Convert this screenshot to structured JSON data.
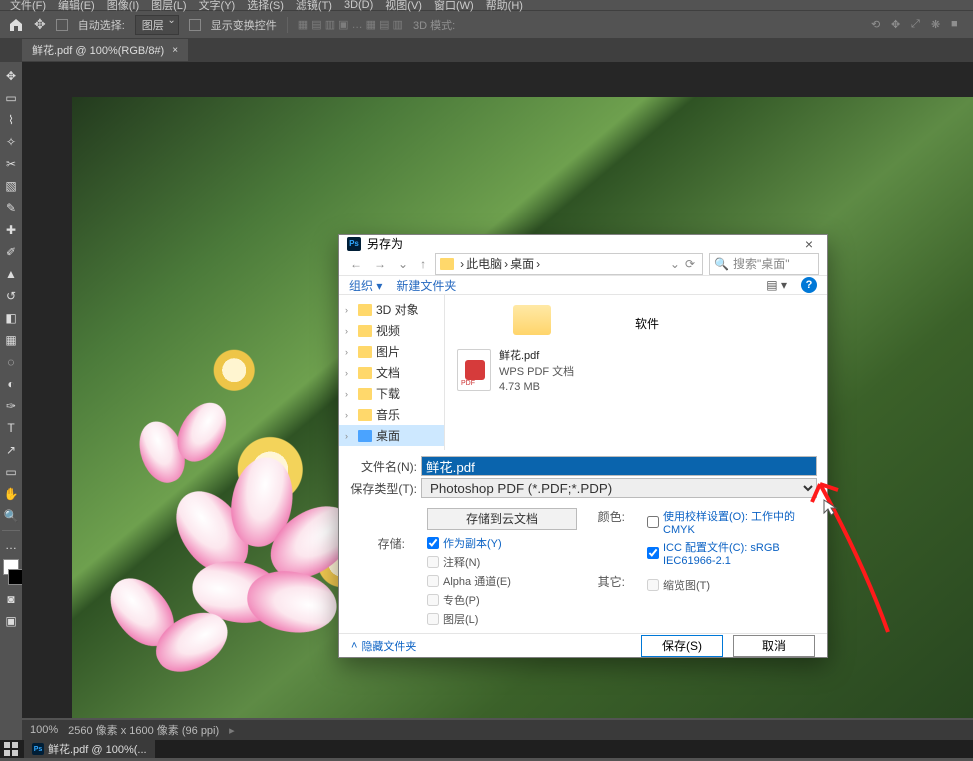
{
  "menu": {
    "file": "文件(F)",
    "edit": "编辑(E)",
    "image": "图像(I)",
    "layer": "图层(L)",
    "type": "文字(Y)",
    "select": "选择(S)",
    "filter": "滤镜(T)",
    "threeD": "3D(D)",
    "view": "视图(V)",
    "window": "窗口(W)",
    "help": "帮助(H)"
  },
  "options": {
    "autoSelect": "自动选择:",
    "layerDropdown": "图层",
    "transformCtrls": "显示变换控件",
    "threeDMode": "3D 模式:"
  },
  "tab": {
    "title": "鲜花.pdf @ 100%(RGB/8#)",
    "close": "×"
  },
  "dialog": {
    "title": "另存为",
    "nav": {
      "back": "←",
      "fwd": "→",
      "up": "↑",
      "refresh": "⟳",
      "crumb1": "此电脑",
      "crumb2": "桌面",
      "sep": "›",
      "searchPlaceholder": "搜索\"桌面\"",
      "dropdown": "⌄"
    },
    "toolbar": {
      "organize": "组织 ▾",
      "newFolder": "新建文件夹",
      "viewIcon": "☰",
      "help": "?"
    },
    "tree": [
      {
        "label": "3D 对象"
      },
      {
        "label": "视频"
      },
      {
        "label": "图片"
      },
      {
        "label": "文档"
      },
      {
        "label": "下载"
      },
      {
        "label": "音乐"
      },
      {
        "label": "桌面",
        "selected": true
      }
    ],
    "files": {
      "folder": {
        "name": "软件"
      },
      "pdf": {
        "name": "鲜花.pdf",
        "type": "WPS PDF 文档",
        "size": "4.73 MB"
      }
    },
    "fields": {
      "nameLabel": "文件名(N):",
      "nameValue": "鲜花.pdf",
      "typeLabel": "保存类型(T):",
      "typeValue": "Photoshop PDF (*.PDF;*.PDP)"
    },
    "opts": {
      "cloudBtn": "存储到云文档",
      "storeLabel": "存储:",
      "asCopy": "作为副本(Y)",
      "notes": "注释(N)",
      "alpha": "Alpha 通道(E)",
      "spot": "专色(P)",
      "layers": "图层(L)",
      "colorLabel": "颜色:",
      "proof": "使用校样设置(O): 工作中的 CMYK",
      "icc": "ICC 配置文件(C): sRGB IEC61966-2.1",
      "otherLabel": "其它:",
      "thumb": "缩览图(T)"
    },
    "footer": {
      "hide": "隐藏文件夹",
      "save": "保存(S)",
      "cancel": "取消"
    }
  },
  "status": {
    "zoom": "100%",
    "dims": "2560 像素 x 1600 像素 (96 ppi)"
  },
  "taskbar": {
    "task": "鲜花.pdf @ 100%(..."
  }
}
